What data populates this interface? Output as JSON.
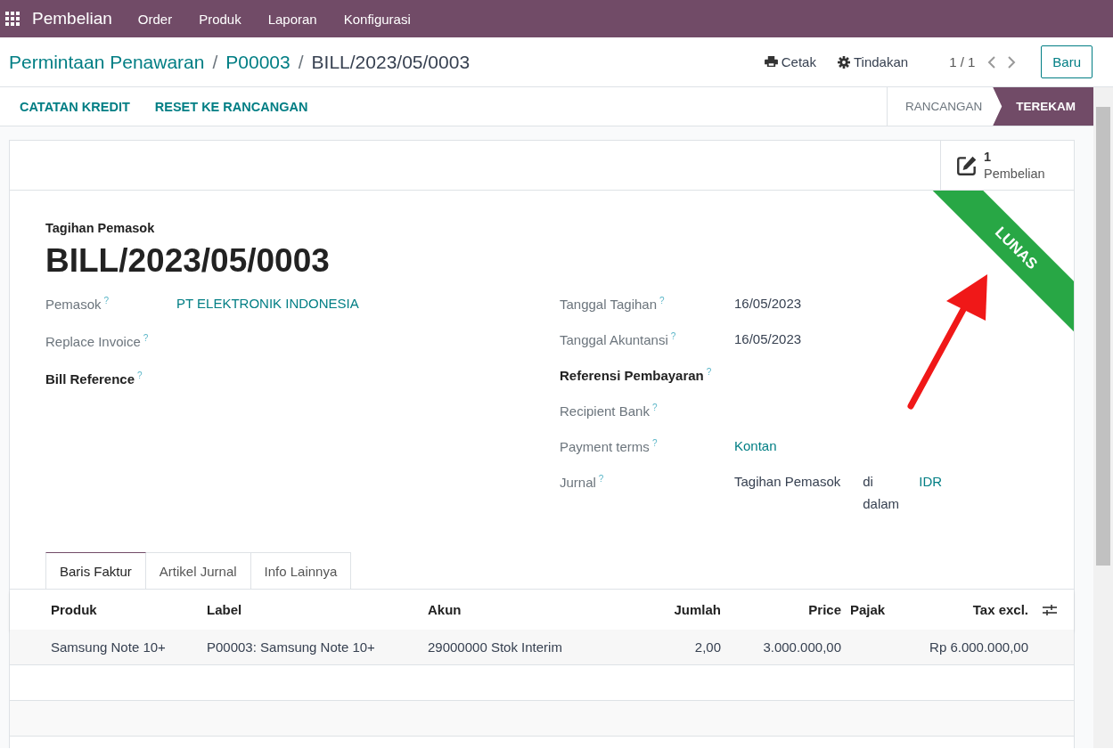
{
  "navbar": {
    "app": "Pembelian",
    "menus": [
      "Order",
      "Produk",
      "Laporan",
      "Konfigurasi"
    ]
  },
  "breadcrumb": {
    "separator": "/",
    "items": [
      "Permintaan Penawaran",
      "P00003",
      "BILL/2023/05/0003"
    ]
  },
  "actions": [
    "Cetak",
    "Tindakan"
  ],
  "pager": "1 / 1",
  "new_button": "Baru",
  "header_buttons": [
    "CATATAN KREDIT",
    "RESET KE RANCANGAN"
  ],
  "statusbar": [
    {
      "label": "RANCANGAN",
      "selected": false
    },
    {
      "label": "TEREKAM",
      "selected": true
    }
  ],
  "stat_button": {
    "count": "1",
    "label": "Pembelian"
  },
  "ribbon": "LUNAS",
  "subtitle": "Tagihan Pemasok",
  "title": "BILL/2023/05/0003",
  "field_columns": [
    [
      {
        "label": "Pemasok",
        "help": "?",
        "bold": false,
        "values": [
          {
            "text": "PT ELEKTRONIK INDONESIA",
            "link": true
          }
        ]
      },
      {
        "label": "Replace Invoice",
        "help": "?",
        "bold": false
      },
      {
        "label": "Bill Reference",
        "help": "?",
        "bold": true
      }
    ],
    [
      {
        "label": "Tanggal Tagihan",
        "help": "?",
        "bold": false,
        "values": [
          {
            "text": "16/05/2023",
            "link": false
          }
        ]
      },
      {
        "label": "Tanggal Akuntansi",
        "help": "?",
        "bold": false,
        "values": [
          {
            "text": "16/05/2023",
            "link": false
          }
        ]
      },
      {
        "label": "Referensi Pembayaran",
        "help": "?",
        "bold": true
      },
      {
        "label": "Recipient Bank",
        "help": "?",
        "bold": false
      },
      {
        "label": "Payment terms",
        "help": "?",
        "bold": false,
        "values": [
          {
            "text": "Kontan",
            "link": true
          }
        ]
      },
      {
        "label": "Jurnal",
        "help": "?",
        "bold": false,
        "values": [
          {
            "text": "Tagihan Pemasok",
            "link": false
          },
          {
            "text": "di dalam",
            "link": false
          },
          {
            "text": "IDR",
            "link": true
          }
        ]
      }
    ]
  ],
  "tabs": [
    {
      "label": "Baris Faktur",
      "selected": true
    },
    {
      "label": "Artikel Jurnal",
      "selected": false
    },
    {
      "label": "Info Lainnya",
      "selected": false
    }
  ],
  "table": {
    "columns": [
      {
        "label": "Produk",
        "kind": "text"
      },
      {
        "label": "Label",
        "kind": "text"
      },
      {
        "label": "Akun",
        "kind": "text"
      },
      {
        "label": "Jumlah",
        "kind": "number"
      },
      {
        "label": "Price",
        "kind": "number"
      },
      {
        "label": "Pajak",
        "kind": "text"
      },
      {
        "label": "Tax excl.",
        "kind": "number"
      }
    ],
    "rows": [
      [
        "Samsung Note 10+",
        "P00003: Samsung Note 10+",
        "29000000 Stok Interim",
        "2,00",
        "3.000.000,00",
        "",
        "Rp 6.000.000,00"
      ]
    ]
  }
}
